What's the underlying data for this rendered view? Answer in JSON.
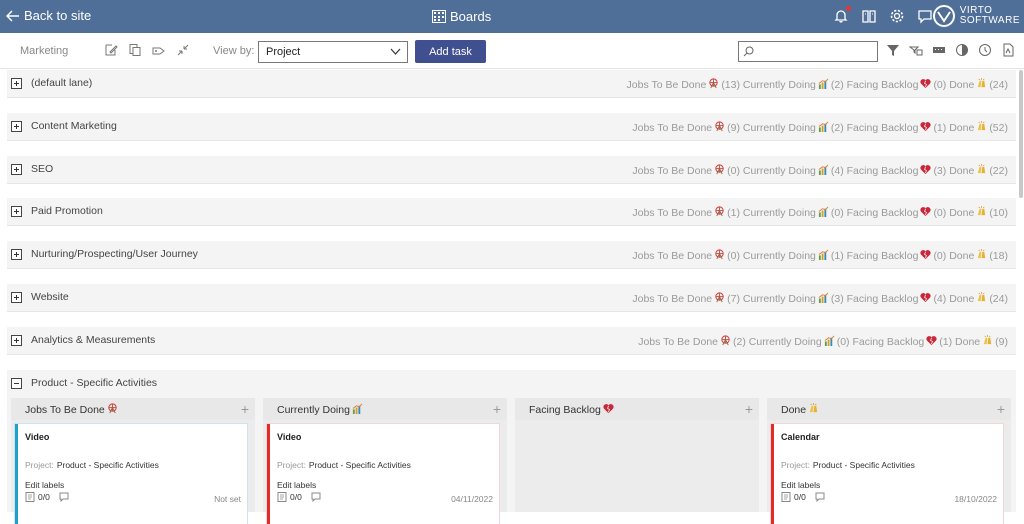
{
  "topbar": {
    "back_label": "Back to site",
    "title": "Boards",
    "logo_line1": "VIRTO",
    "logo_line2": "SOFTWARE",
    "icons": [
      "bell-icon",
      "book-icon",
      "gear-icon",
      "chat-icon"
    ]
  },
  "toolbar": {
    "breadcrumb": "Marketing",
    "icons": [
      "edit-icon",
      "copy-icon",
      "tag-icon",
      "collapse-icon"
    ],
    "view_by_label": "View by:",
    "view_by_value": "Project",
    "add_task_label": "Add task",
    "search_placeholder": "",
    "right_icons": [
      "filter-icon",
      "filter-settings-icon",
      "keyboard-icon",
      "palette-icon",
      "history-icon",
      "pdf-icon"
    ]
  },
  "lanes": [
    {
      "name": "(default lane)",
      "stats": [
        {
          "label": "Jobs To Be Done",
          "count": "(13)"
        },
        {
          "label": "Currently Doing",
          "count": "(2)"
        },
        {
          "label": "Facing Backlog",
          "count": "(0)"
        },
        {
          "label": "Done",
          "count": "(24)"
        }
      ]
    },
    {
      "name": "Content Marketing",
      "stats": [
        {
          "label": "Jobs To Be Done",
          "count": "(9)"
        },
        {
          "label": "Currently Doing",
          "count": "(2)"
        },
        {
          "label": "Facing Backlog",
          "count": "(1)"
        },
        {
          "label": "Done",
          "count": "(52)"
        }
      ]
    },
    {
      "name": "SEO",
      "stats": [
        {
          "label": "Jobs To Be Done",
          "count": "(0)"
        },
        {
          "label": "Currently Doing",
          "count": "(4)"
        },
        {
          "label": "Facing Backlog",
          "count": "(3)"
        },
        {
          "label": "Done",
          "count": "(22)"
        }
      ]
    },
    {
      "name": "Paid Promotion",
      "stats": [
        {
          "label": "Jobs To Be Done",
          "count": "(1)"
        },
        {
          "label": "Currently Doing",
          "count": "(0)"
        },
        {
          "label": "Facing Backlog",
          "count": "(0)"
        },
        {
          "label": "Done",
          "count": "(10)"
        }
      ]
    },
    {
      "name": "Nurturing/Prospecting/User Journey",
      "stats": [
        {
          "label": "Jobs To Be Done",
          "count": "(0)"
        },
        {
          "label": "Currently Doing",
          "count": "(1)"
        },
        {
          "label": "Facing Backlog",
          "count": "(0)"
        },
        {
          "label": "Done",
          "count": "(18)"
        }
      ]
    },
    {
      "name": "Website",
      "stats": [
        {
          "label": "Jobs To Be Done",
          "count": "(7)"
        },
        {
          "label": "Currently Doing",
          "count": "(3)"
        },
        {
          "label": "Facing Backlog",
          "count": "(4)"
        },
        {
          "label": "Done",
          "count": "(24)"
        }
      ]
    },
    {
      "name": "Analytics & Measurements",
      "stats": [
        {
          "label": "Jobs To Be Done",
          "count": "(2)"
        },
        {
          "label": "Currently Doing",
          "count": "(0)"
        },
        {
          "label": "Facing Backlog",
          "count": "(1)"
        },
        {
          "label": "Done",
          "count": "(9)"
        }
      ]
    }
  ],
  "expanded_lane": {
    "name": "Product - Specific Activities",
    "columns": [
      {
        "title": "Jobs To Be Done",
        "add": "+",
        "card": {
          "title": "Video",
          "project_label": "Project:",
          "project": "Product - Specific Activities",
          "labels": "Edit labels",
          "count": "0/0",
          "date": "Not set",
          "accent": "#1ea0c8"
        }
      },
      {
        "title": "Currently Doing",
        "add": "+",
        "card": {
          "title": "Video",
          "project_label": "Project:",
          "project": "Product - Specific Activities",
          "labels": "Edit labels",
          "count": "0/0",
          "date": "04/11/2022",
          "accent": "#e52a2a"
        }
      },
      {
        "title": "Facing Backlog",
        "add": "+"
      },
      {
        "title": "Done",
        "add": "+",
        "card": {
          "title": "Calendar",
          "project_label": "Project:",
          "project": "Product - Specific Activities",
          "labels": "Edit labels",
          "count": "0/0",
          "date": "18/10/2022",
          "accent": "#e52a2a"
        }
      }
    ]
  },
  "colors": {
    "topbar": "#4f6f98",
    "add_task": "#3f4f8f",
    "card_blue": "#1ea0c8",
    "card_red": "#e52a2a"
  }
}
